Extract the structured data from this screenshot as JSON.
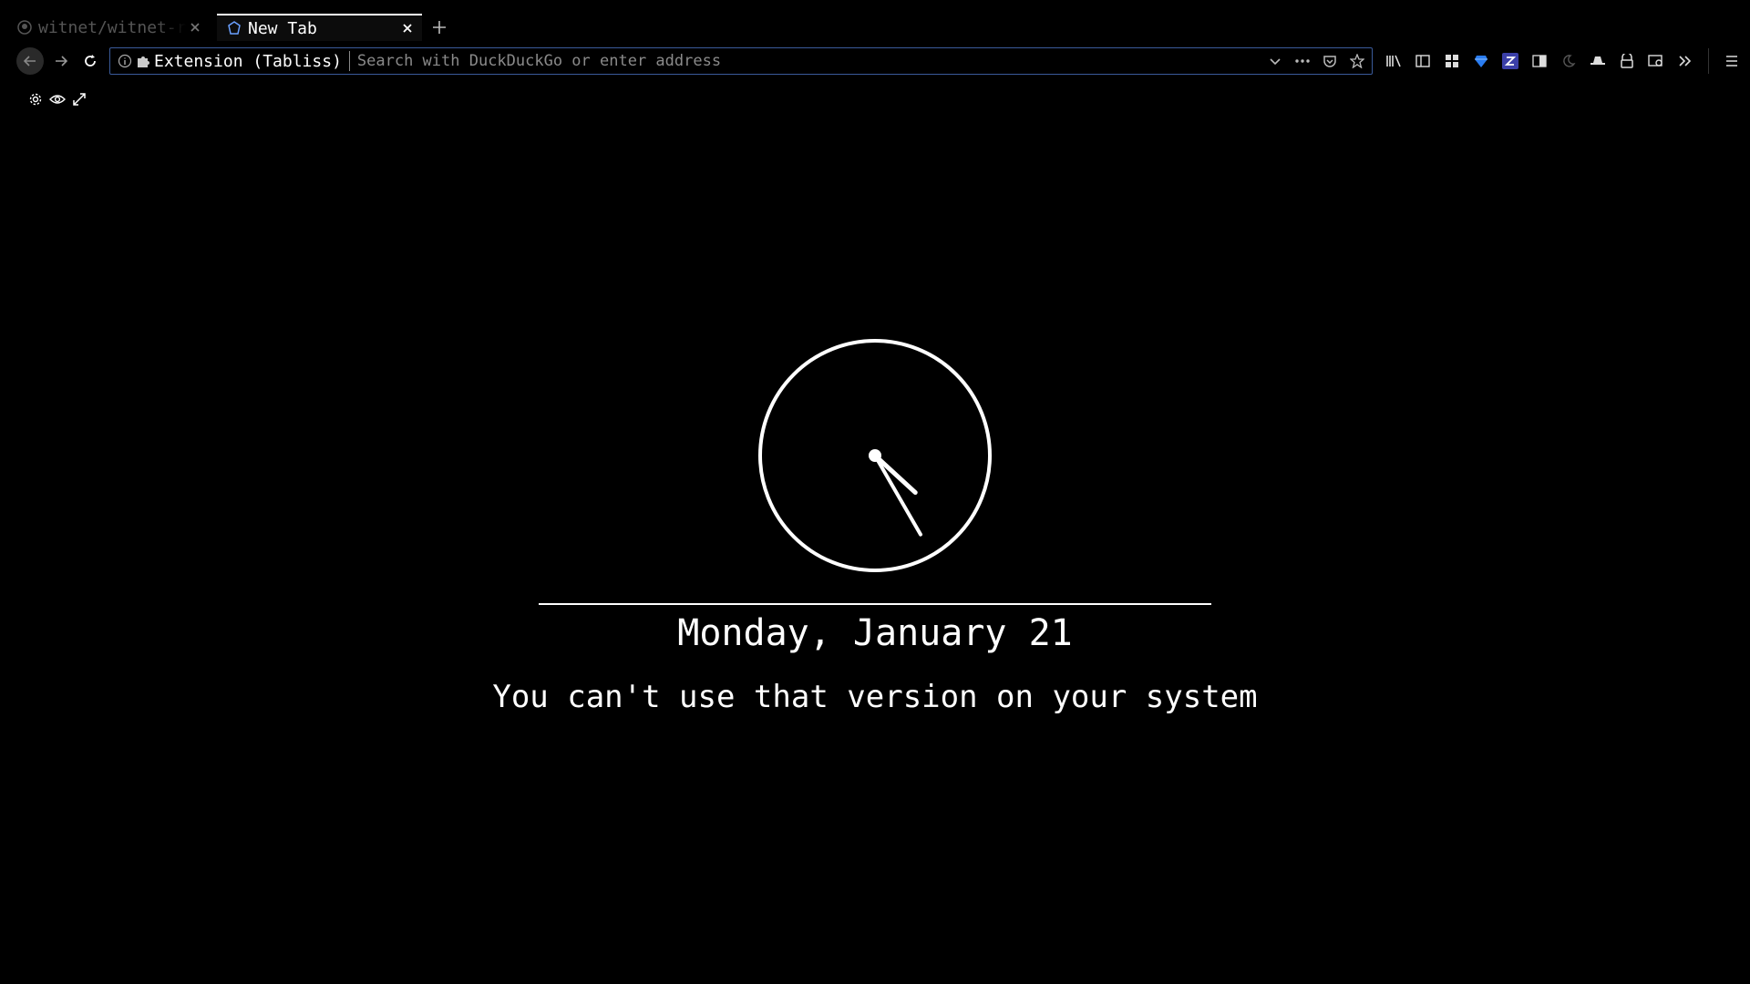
{
  "tabs": [
    {
      "title": "witnet/witnet-rust",
      "icon": "github-icon",
      "active": false
    },
    {
      "title": "New Tab",
      "icon": "tabliss-icon",
      "active": true
    }
  ],
  "navbar": {
    "identity_label": "Extension (Tabliss)",
    "url_placeholder": "Search with DuckDuckGo or enter address",
    "url_value": ""
  },
  "toolbar": {
    "icons": [
      "library-icon",
      "sidebar-icon",
      "containers-icon",
      "gem-extension-icon",
      "z-extension-icon",
      "reader-icon",
      "moon-icon",
      "hat-extension-icon",
      "vpn-extension-icon",
      "screenshot-icon",
      "overflow-icon",
      "menu-icon"
    ]
  },
  "page": {
    "controls": [
      "gear-icon",
      "eye-icon",
      "fullscreen-icon"
    ],
    "clock": {
      "hour": 4,
      "minute": 25
    },
    "date": "Monday, January 21",
    "message": "You can't use that version on your system"
  },
  "colors": {
    "background": "#000000",
    "foreground": "#ffffff",
    "urlbar_border": "#3a5a9a"
  }
}
